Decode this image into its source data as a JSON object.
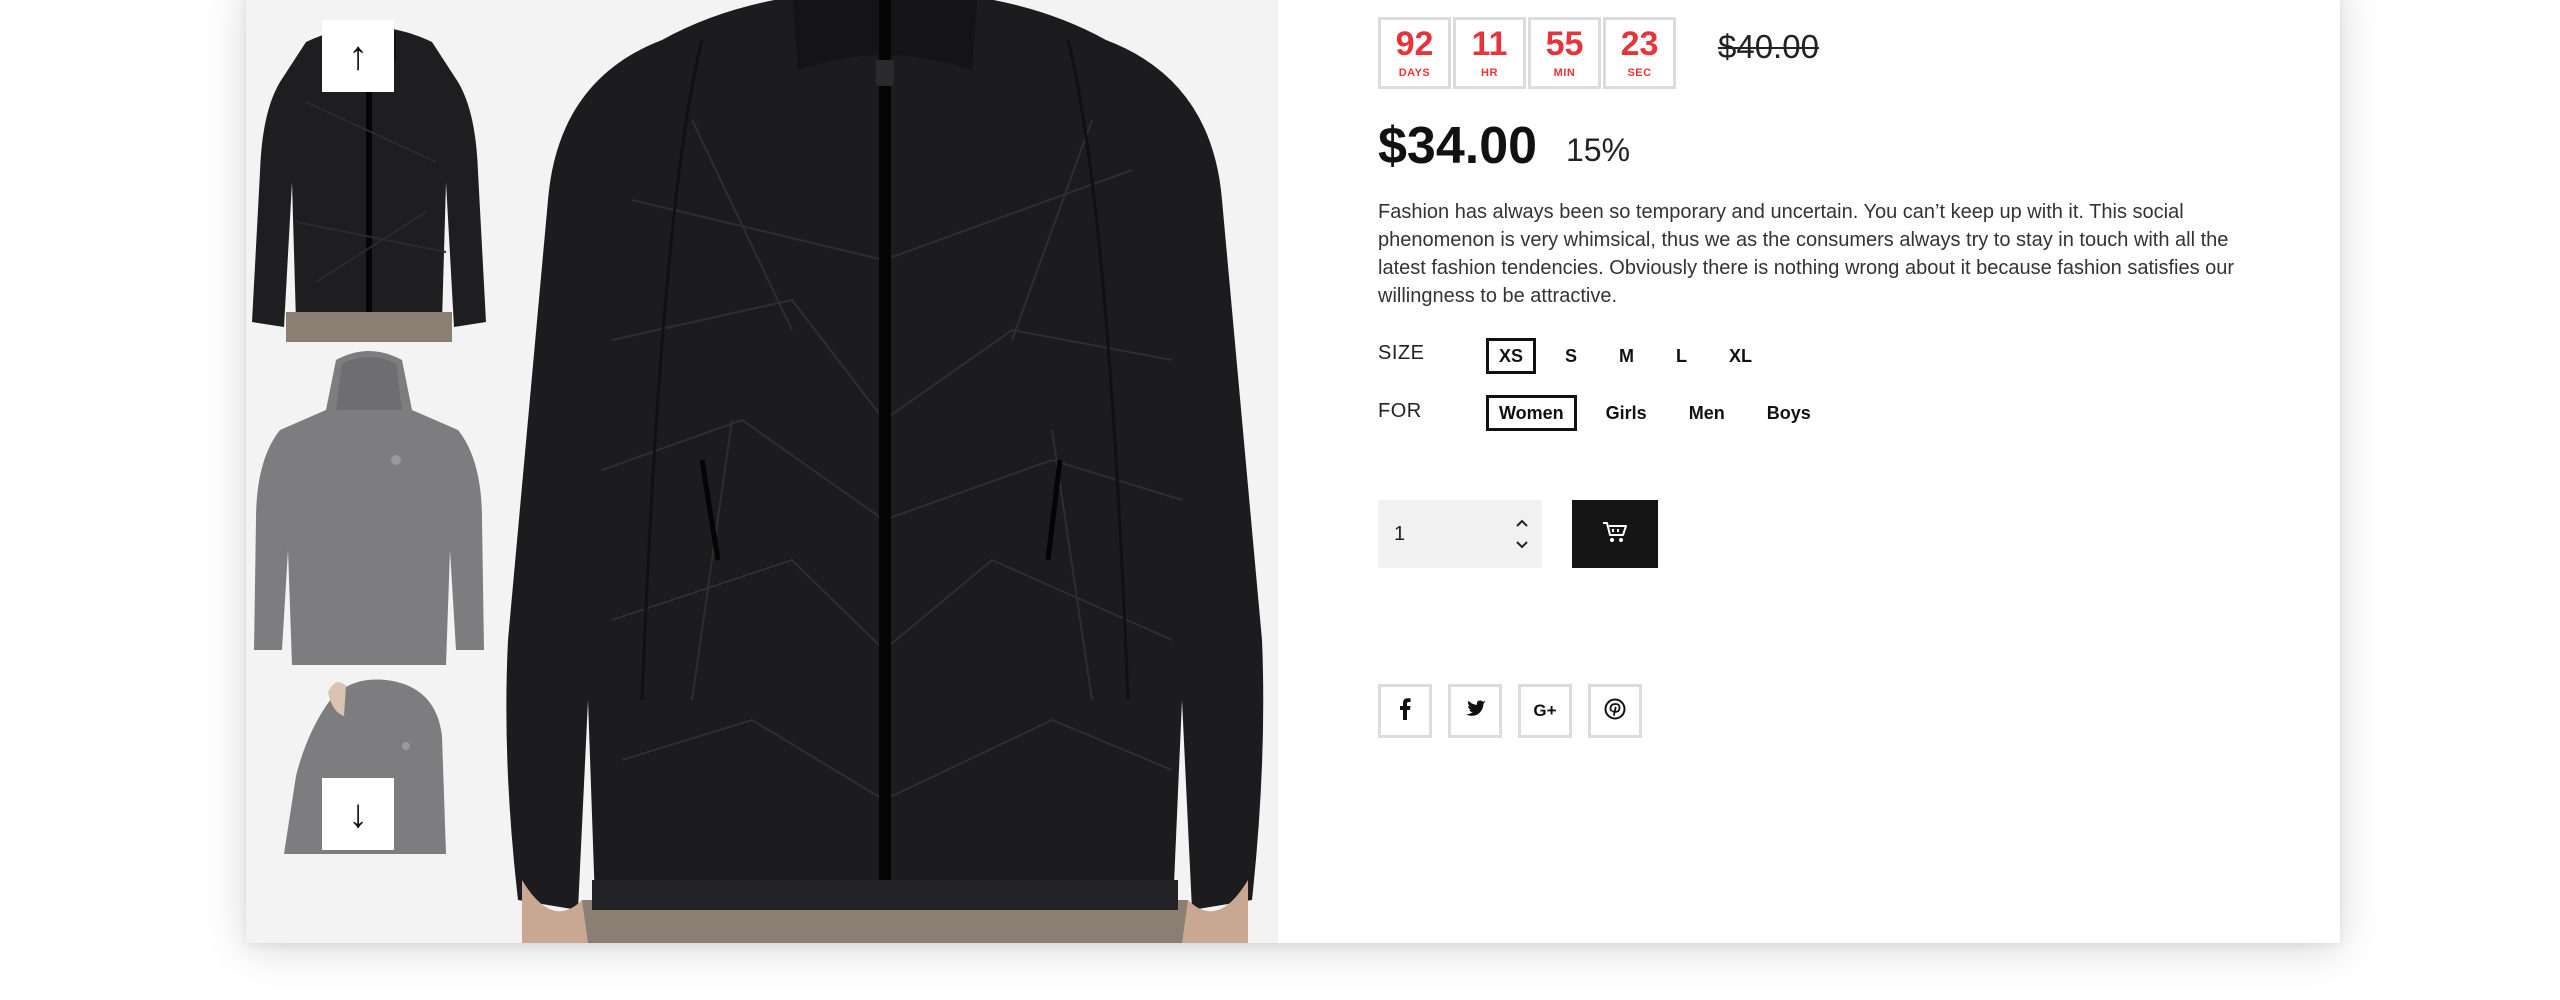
{
  "thumbnails": {
    "up_icon": "up-arrow-icon",
    "down_icon": "down-arrow-icon",
    "up_glyph": "↑",
    "down_glyph": "↓",
    "items": [
      {
        "view": "front"
      },
      {
        "view": "back"
      },
      {
        "view": "side"
      }
    ]
  },
  "timer": {
    "accent_color": "#e7343a",
    "cells": [
      {
        "value": "92",
        "unit": "DAYS"
      },
      {
        "value": "11",
        "unit": "HR"
      },
      {
        "value": "55",
        "unit": "MIN"
      },
      {
        "value": "23",
        "unit": "SEC"
      }
    ]
  },
  "pricing": {
    "old_price": "$40.00",
    "price": "$34.00",
    "discount": "15%"
  },
  "description": "Fashion has always been so temporary and uncertain. You can’t keep up with it.  This social phenomenon is very whimsical, thus we as the consumers always try to stay in touch with all the latest fashion tendencies. Obviously there is nothing wrong about it because fashion satisfies our willingness to be attractive.",
  "options": {
    "size": {
      "label": "SIZE",
      "values": [
        "XS",
        "S",
        "M",
        "L",
        "XL"
      ],
      "selected": "XS"
    },
    "for": {
      "label": "FOR",
      "values": [
        "Women",
        "Girls",
        "Men",
        "Boys"
      ],
      "selected": "Women"
    }
  },
  "quantity": {
    "value": "1",
    "up_icon": "chevron-up-icon",
    "down_icon": "chevron-down-icon"
  },
  "cart": {
    "icon": "cart-icon",
    "bg_color": "#141414"
  },
  "social": [
    {
      "name": "facebook",
      "icon": "facebook-icon",
      "glyph": "f"
    },
    {
      "name": "twitter",
      "icon": "twitter-icon",
      "glyph": "t"
    },
    {
      "name": "google-plus",
      "icon": "google-plus-icon",
      "glyph": "G+"
    },
    {
      "name": "pinterest",
      "icon": "pinterest-icon",
      "glyph": "p"
    }
  ]
}
